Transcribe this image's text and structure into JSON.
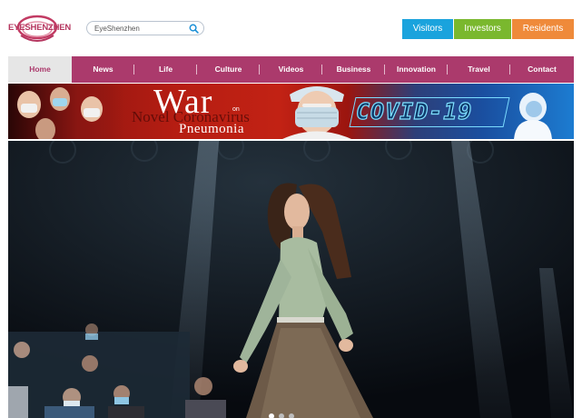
{
  "header": {
    "logo_text": "EYESHENZHEN",
    "search": {
      "placeholder": "EyeShenzhen"
    },
    "audience_buttons": [
      {
        "label": "Visitors",
        "color": "#1aa3dd"
      },
      {
        "label": "Investors",
        "color": "#7ab82e"
      },
      {
        "label": "Residents",
        "color": "#ef8a3a"
      }
    ]
  },
  "nav": {
    "color": "#ab3a6c",
    "active": "Home",
    "items": [
      {
        "label": "Home"
      },
      {
        "label": "News"
      },
      {
        "label": "Life"
      },
      {
        "label": "Culture"
      },
      {
        "label": "Videos"
      },
      {
        "label": "Business"
      },
      {
        "label": "Innovation"
      },
      {
        "label": "Travel"
      },
      {
        "label": "Contact"
      }
    ]
  },
  "banner": {
    "title": "War",
    "on": "on",
    "subtitle_overlay": "Novel Coronavirus",
    "subtitle": "Pneumonia",
    "tag": "COVID-19"
  },
  "hero": {
    "slide_count": 3,
    "active_slide": 1
  }
}
